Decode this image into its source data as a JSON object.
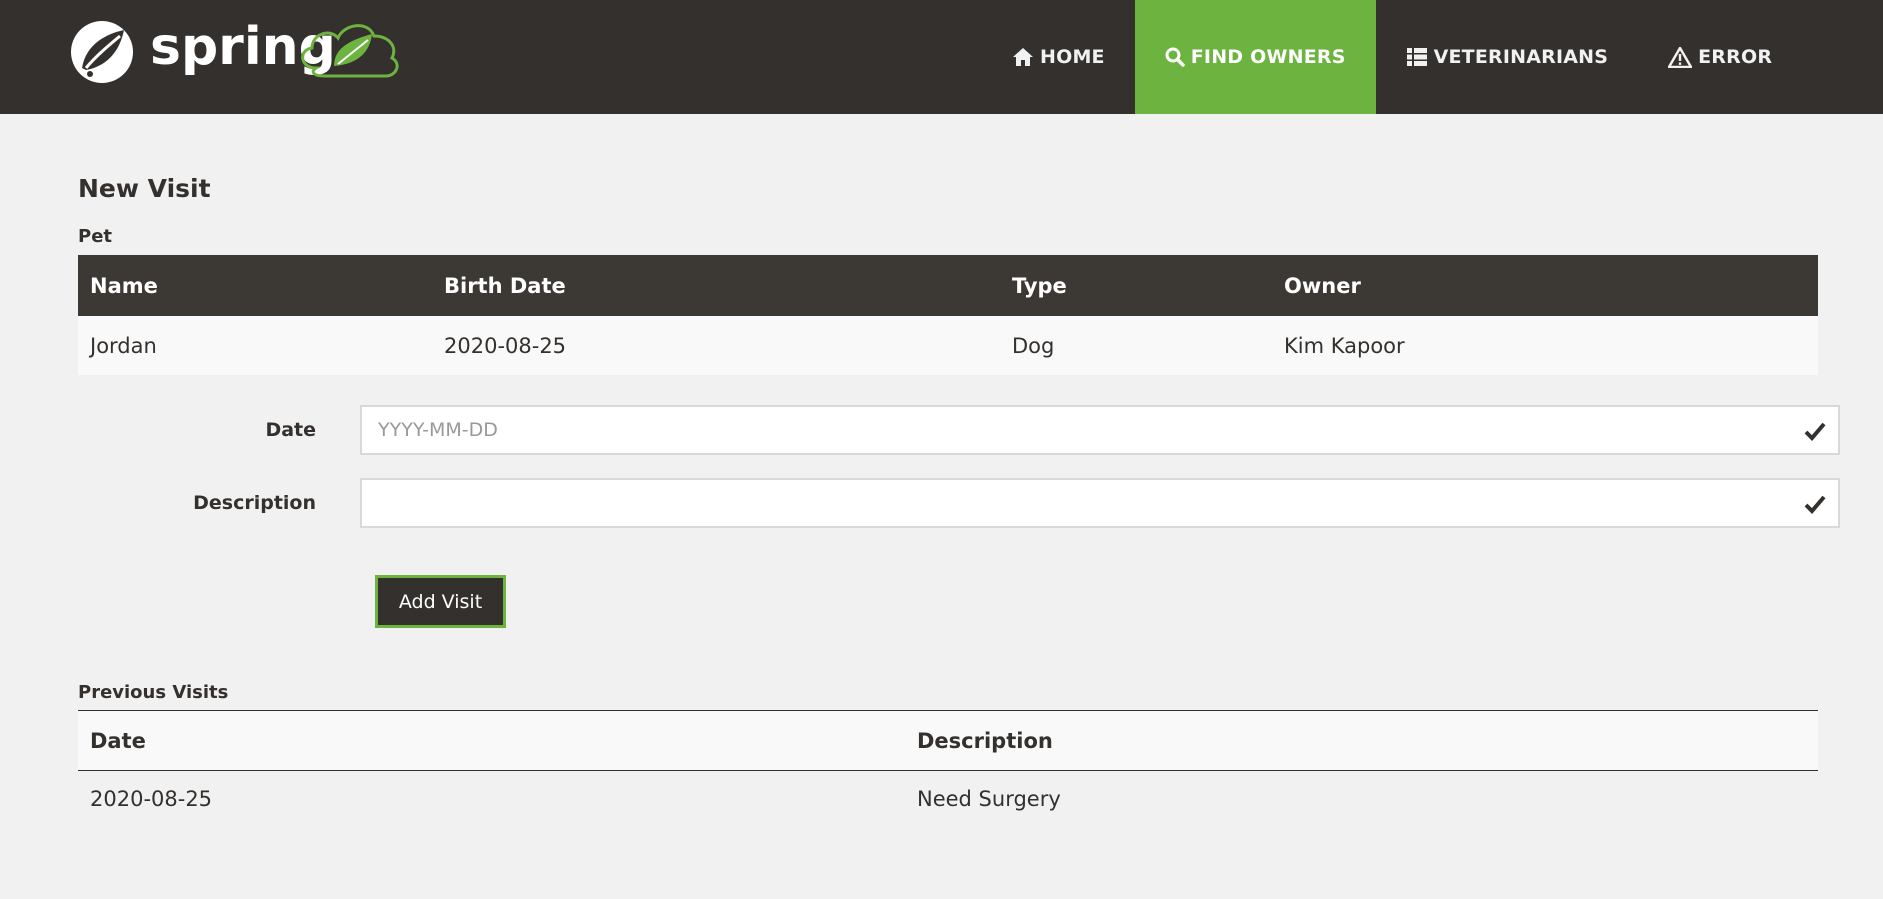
{
  "brand": {
    "logo_text": "spring"
  },
  "nav": {
    "items": [
      {
        "label": "HOME",
        "icon": "home-icon",
        "active": false
      },
      {
        "label": "FIND OWNERS",
        "icon": "search-icon",
        "active": true
      },
      {
        "label": "VETERINARIANS",
        "icon": "list-icon",
        "active": false
      },
      {
        "label": "ERROR",
        "icon": "warning-icon",
        "active": false
      }
    ]
  },
  "page": {
    "title": "New Visit",
    "pet_section_label": "Pet"
  },
  "pet_table": {
    "headers": [
      "Name",
      "Birth Date",
      "Type",
      "Owner"
    ],
    "row": [
      "Jordan",
      "2020-08-25",
      "Dog",
      "Kim Kapoor"
    ]
  },
  "form": {
    "date_label": "Date",
    "date_value": "",
    "date_placeholder": "YYYY-MM-DD",
    "description_label": "Description",
    "description_value": "",
    "submit_label": "Add Visit"
  },
  "previous_visits": {
    "label": "Previous Visits",
    "headers": [
      "Date",
      "Description"
    ],
    "rows": [
      [
        "2020-08-25",
        "Need Surgery"
      ]
    ]
  },
  "colors": {
    "navbar": "#34302d",
    "accent": "#6db33f",
    "background": "#f1f1f1"
  }
}
